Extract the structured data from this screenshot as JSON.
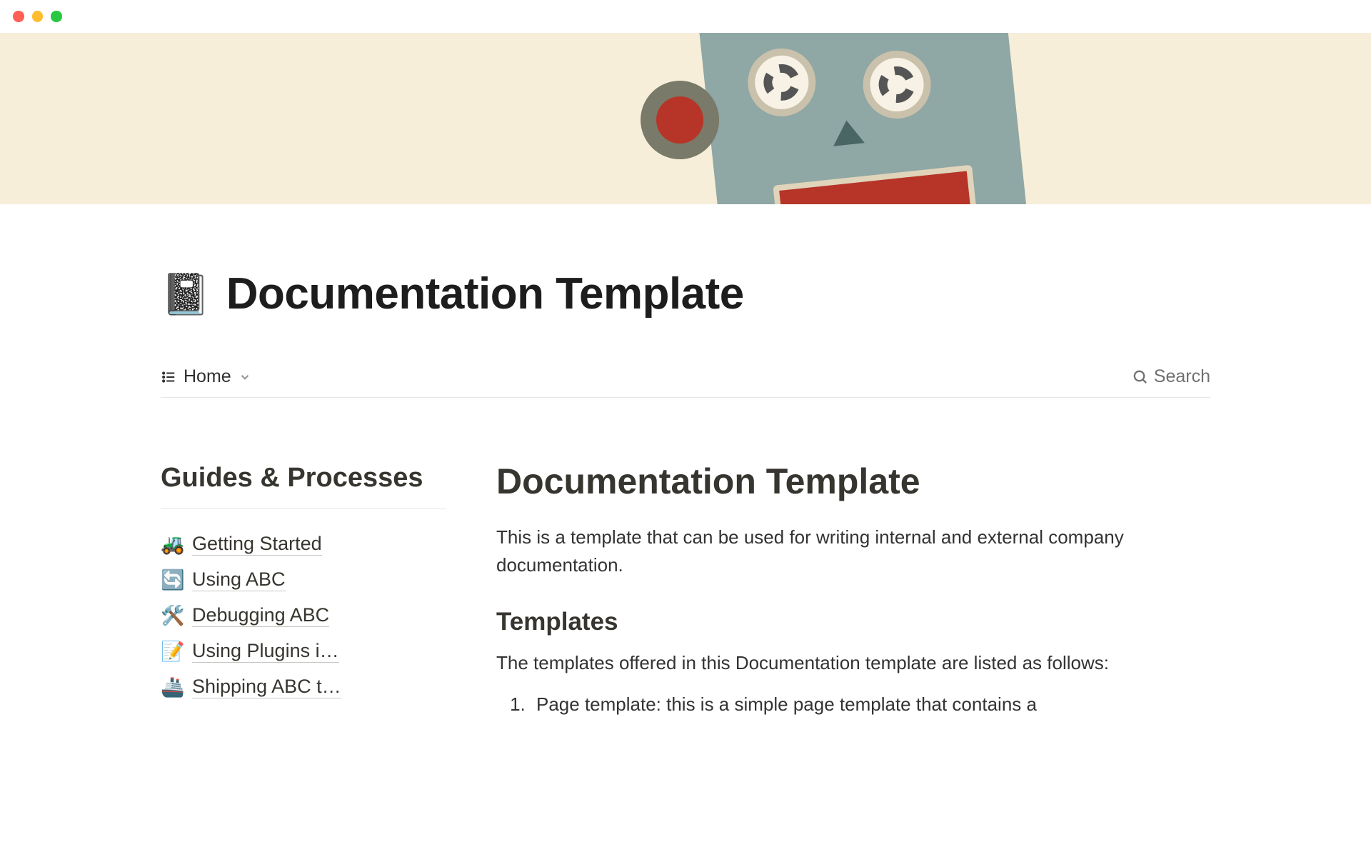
{
  "page": {
    "emoji": "📓",
    "title": "Documentation Template"
  },
  "breadcrumb": {
    "label": "Home"
  },
  "search": {
    "label": "Search"
  },
  "sidebar": {
    "heading": "Guides & Processes",
    "items": [
      {
        "emoji": "🚜",
        "label": "Getting Started"
      },
      {
        "emoji": "🔄",
        "label": "Using ABC"
      },
      {
        "emoji": "🛠️",
        "label": "Debugging ABC"
      },
      {
        "emoji": "📝",
        "label": "Using Plugins i…"
      },
      {
        "emoji": "🚢",
        "label": "Shipping ABC t…"
      }
    ]
  },
  "content": {
    "h1": "Documentation Template",
    "intro": "This is a template that can be used for writing internal and external company documentation.",
    "h2": "Templates",
    "templates_intro": "The templates offered in this Documentation template are listed as follows:",
    "list": [
      "Page template: this is a simple page template that contains a"
    ]
  }
}
